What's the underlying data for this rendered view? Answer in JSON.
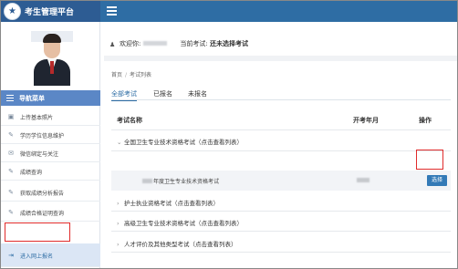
{
  "header": {
    "title": "考生管理平台",
    "logo_icon": "seal-logo-icon",
    "menu_icon": "hamburger-icon",
    "bar_color": "#2e6da4",
    "brand_color": "#2d5c93"
  },
  "sidebar": {
    "nav_title": "导航菜单",
    "items": [
      {
        "label": "上传基本照片",
        "icon": "upload-photo-icon"
      },
      {
        "label": "学历学位信息维护",
        "icon": "degree-icon"
      },
      {
        "label": "微信绑定与关注",
        "icon": "wechat-icon"
      },
      {
        "label": "成绩查询",
        "icon": "score-icon"
      },
      {
        "label": "获取成绩分析报告",
        "icon": "report-icon"
      },
      {
        "label": "成绩合格证明查询",
        "icon": "certificate-icon"
      },
      {
        "label": "进入网上报名",
        "icon": "enter-icon",
        "active": true
      }
    ]
  },
  "welcome": {
    "greeting": "欢迎你:",
    "current_exam_label": "当前考试:",
    "current_exam_value": "还未选择考试"
  },
  "breadcrumb": {
    "home": "首页",
    "separator": "/",
    "current": "考试列表"
  },
  "tabs": [
    {
      "label": "全部考试",
      "active": true
    },
    {
      "label": "已报名",
      "active": false
    },
    {
      "label": "未报名",
      "active": false
    }
  ],
  "table": {
    "columns": [
      "考试名称",
      "开考年月",
      "操作"
    ],
    "groups": [
      {
        "label": "全国卫生专业技术资格考试（点击查看列表）",
        "expanded": true,
        "children": [
          {
            "name": "年度卫生专业技术资格考试",
            "action": "选择"
          }
        ]
      },
      {
        "label": "护士执业资格考试（点击查看列表）",
        "expanded": false
      },
      {
        "label": "高级卫生专业技术资格考试（点击查看列表）",
        "expanded": false
      },
      {
        "label": "人才评价及其他类型考试（点击查看列表）",
        "expanded": false
      }
    ]
  },
  "accent_color": "#337ab7",
  "highlight_color": "#e02b2b"
}
